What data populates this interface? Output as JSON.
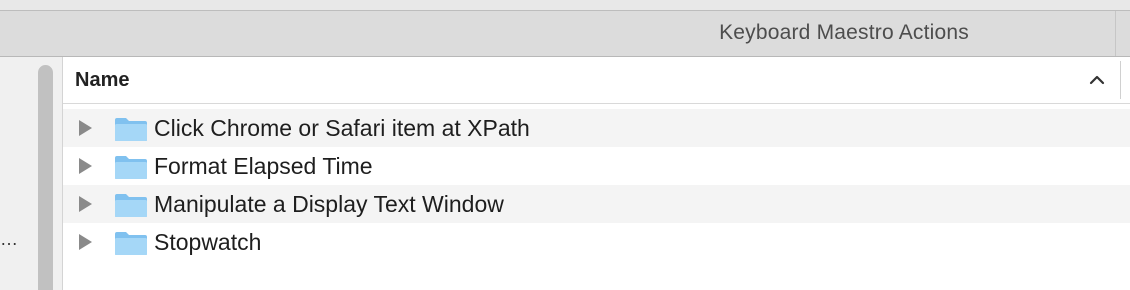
{
  "window": {
    "title": "Keyboard Maestro Actions"
  },
  "sidebar": {
    "overflow_indicator": "…"
  },
  "list": {
    "column_header": "Name",
    "sort_icon": "chevron-up-icon",
    "rows": [
      {
        "label": "Click Chrome or Safari item at XPath",
        "icon": "folder-icon"
      },
      {
        "label": "Format Elapsed Time",
        "icon": "folder-icon"
      },
      {
        "label": "Manipulate a Display Text Window",
        "icon": "folder-icon"
      },
      {
        "label": "Stopwatch",
        "icon": "folder-icon"
      }
    ]
  },
  "colors": {
    "folder": "#a5d7f7",
    "folder_dark": "#80c1ef",
    "alt_row": "#f4f4f4"
  }
}
